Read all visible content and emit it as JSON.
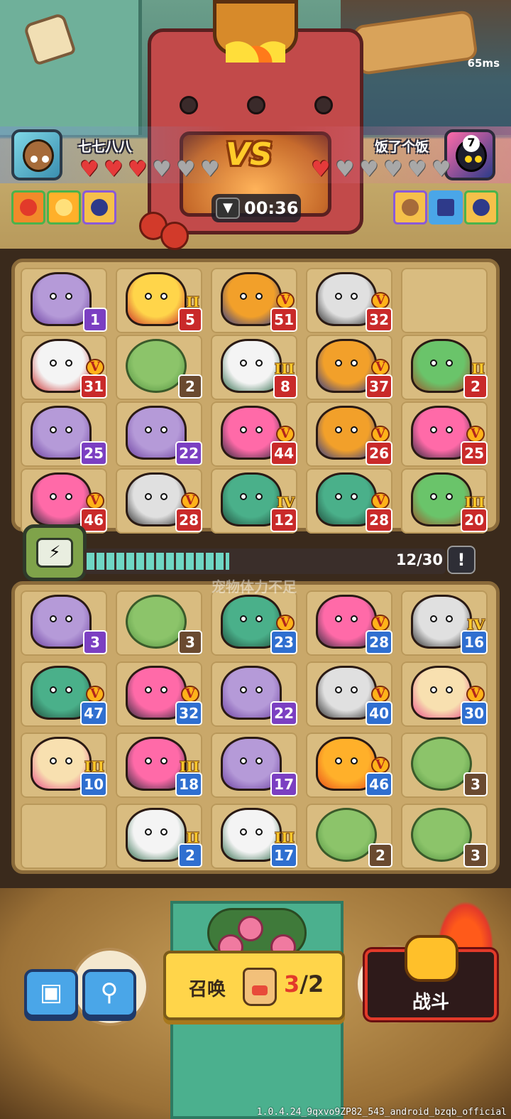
{
  "status": {
    "ping": "65ms"
  },
  "player": {
    "name": "七七八八",
    "hearts_full": 3,
    "hearts_total": 6
  },
  "opponent": {
    "name": "饭了个饭",
    "hearts_full": 1,
    "hearts_total": 6,
    "badge": "7"
  },
  "vs_label": "VS",
  "timer": {
    "value": "00:36"
  },
  "enemy_board": {
    "units": [
      {
        "row": 0,
        "col": 0,
        "level": "1",
        "badge": "purple",
        "rank": "",
        "kind": "witch"
      },
      {
        "row": 0,
        "col": 1,
        "level": "5",
        "badge": "red",
        "rank": "II",
        "kind": "dog-hero"
      },
      {
        "row": 0,
        "col": 2,
        "level": "51",
        "badge": "red",
        "rank": "V",
        "kind": "fox-hero"
      },
      {
        "row": 0,
        "col": 3,
        "level": "32",
        "badge": "red",
        "rank": "V",
        "kind": "spiky-robot"
      },
      {
        "row": 1,
        "col": 0,
        "level": "31",
        "badge": "red",
        "rank": "V",
        "kind": "ninja"
      },
      {
        "row": 1,
        "col": 1,
        "level": "2",
        "badge": "brown",
        "rank": "",
        "kind": "cabbage"
      },
      {
        "row": 1,
        "col": 2,
        "level": "8",
        "badge": "red",
        "rank": "III",
        "kind": "cat-guard"
      },
      {
        "row": 1,
        "col": 3,
        "level": "37",
        "badge": "red",
        "rank": "V",
        "kind": "fox-hero"
      },
      {
        "row": 1,
        "col": 4,
        "level": "2",
        "badge": "red",
        "rank": "II",
        "kind": "turtle"
      },
      {
        "row": 2,
        "col": 0,
        "level": "25",
        "badge": "purple",
        "rank": "",
        "kind": "witch"
      },
      {
        "row": 2,
        "col": 1,
        "level": "22",
        "badge": "purple",
        "rank": "",
        "kind": "witch"
      },
      {
        "row": 2,
        "col": 2,
        "level": "44",
        "badge": "red",
        "rank": "V",
        "kind": "pink-cat"
      },
      {
        "row": 2,
        "col": 3,
        "level": "26",
        "badge": "red",
        "rank": "V",
        "kind": "fox-hero"
      },
      {
        "row": 2,
        "col": 4,
        "level": "25",
        "badge": "red",
        "rank": "V",
        "kind": "pink-cat"
      },
      {
        "row": 3,
        "col": 0,
        "level": "46",
        "badge": "red",
        "rank": "V",
        "kind": "pink-cat"
      },
      {
        "row": 3,
        "col": 1,
        "level": "28",
        "badge": "red",
        "rank": "V",
        "kind": "spiky-robot"
      },
      {
        "row": 3,
        "col": 2,
        "level": "12",
        "badge": "red",
        "rank": "IV",
        "kind": "green-knight"
      },
      {
        "row": 3,
        "col": 3,
        "level": "28",
        "badge": "red",
        "rank": "V",
        "kind": "green-knight"
      },
      {
        "row": 3,
        "col": 4,
        "level": "20",
        "badge": "red",
        "rank": "III",
        "kind": "turtle"
      }
    ]
  },
  "energy": {
    "count": "12/30",
    "fill": 0.4,
    "notice": "!"
  },
  "ghost_text": "宠物体力不足",
  "my_board": {
    "units": [
      {
        "row": 0,
        "col": 0,
        "level": "3",
        "badge": "purple",
        "rank": "",
        "kind": "witch"
      },
      {
        "row": 0,
        "col": 1,
        "level": "3",
        "badge": "brown",
        "rank": "",
        "kind": "cabbage"
      },
      {
        "row": 0,
        "col": 2,
        "level": "23",
        "badge": "blue",
        "rank": "V",
        "kind": "green-knight"
      },
      {
        "row": 0,
        "col": 3,
        "level": "28",
        "badge": "blue",
        "rank": "V",
        "kind": "pink-cat"
      },
      {
        "row": 0,
        "col": 4,
        "level": "16",
        "badge": "blue",
        "rank": "IV",
        "kind": "spiky-robot"
      },
      {
        "row": 1,
        "col": 0,
        "level": "47",
        "badge": "blue",
        "rank": "V",
        "kind": "green-knight"
      },
      {
        "row": 1,
        "col": 1,
        "level": "32",
        "badge": "blue",
        "rank": "V",
        "kind": "pink-cat"
      },
      {
        "row": 1,
        "col": 2,
        "level": "22",
        "badge": "purple",
        "rank": "",
        "kind": "witch"
      },
      {
        "row": 1,
        "col": 3,
        "level": "40",
        "badge": "blue",
        "rank": "V",
        "kind": "spiky-robot"
      },
      {
        "row": 1,
        "col": 4,
        "level": "30",
        "badge": "blue",
        "rank": "V",
        "kind": "lady"
      },
      {
        "row": 2,
        "col": 0,
        "level": "10",
        "badge": "blue",
        "rank": "III",
        "kind": "lady"
      },
      {
        "row": 2,
        "col": 1,
        "level": "18",
        "badge": "blue",
        "rank": "III",
        "kind": "pink-cat"
      },
      {
        "row": 2,
        "col": 2,
        "level": "17",
        "badge": "purple",
        "rank": "",
        "kind": "witch"
      },
      {
        "row": 2,
        "col": 3,
        "level": "46",
        "badge": "blue",
        "rank": "V",
        "kind": "phoenix"
      },
      {
        "row": 2,
        "col": 4,
        "level": "3",
        "badge": "brown",
        "rank": "",
        "kind": "cabbage"
      },
      {
        "row": 3,
        "col": 1,
        "level": "2",
        "badge": "blue",
        "rank": "II",
        "kind": "cat-guard"
      },
      {
        "row": 3,
        "col": 2,
        "level": "17",
        "badge": "blue",
        "rank": "III",
        "kind": "cat-guard"
      },
      {
        "row": 3,
        "col": 3,
        "level": "2",
        "badge": "brown",
        "rank": "",
        "kind": "cabbage"
      },
      {
        "row": 3,
        "col": 4,
        "level": "3",
        "badge": "brown",
        "rank": "",
        "kind": "cabbage"
      }
    ]
  },
  "actions": {
    "chat_icon": "chat-icon",
    "search_icon": "search-icon",
    "summon_label": "召唤",
    "summon_current": "3",
    "summon_total": "/2",
    "fight_label": "战斗"
  },
  "build": "1.0.4.24_9qxvo9ZP82_543_android_bzqb_official",
  "colors": {
    "accent": "#ffd54a",
    "fight": "#e23a2a",
    "enemy_badge": "#c92a2a",
    "my_badge": "#2f6fd0"
  }
}
